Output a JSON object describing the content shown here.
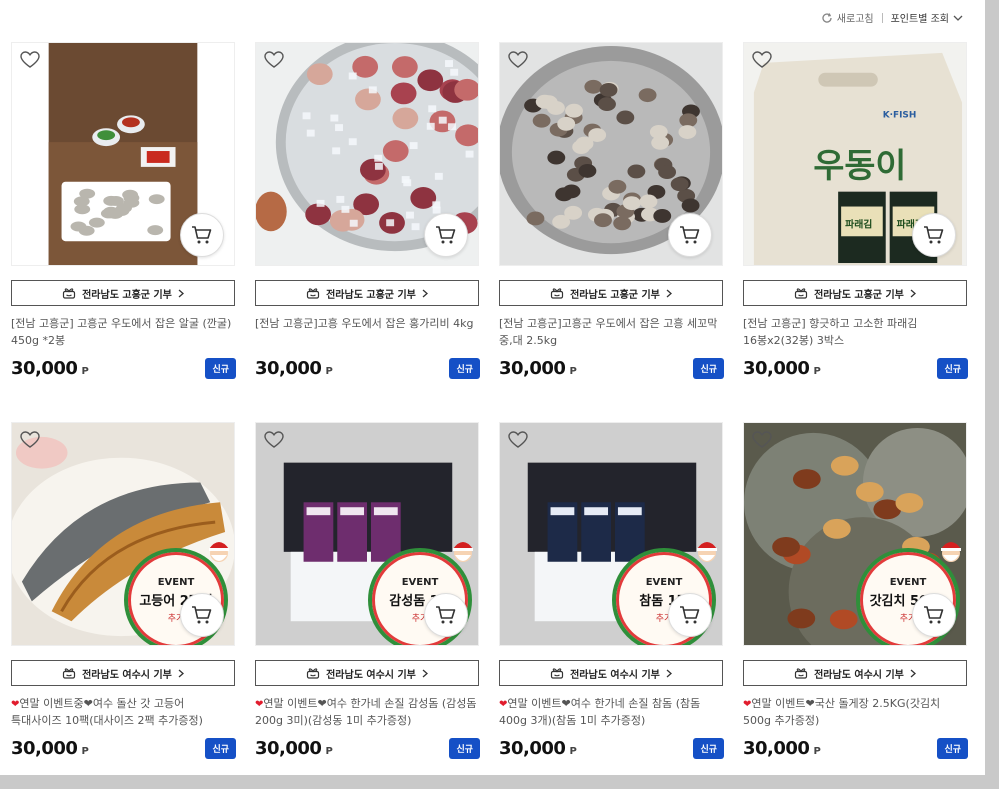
{
  "toolbar": {
    "refresh_label": "새로고침",
    "sort_label": "포인트별 조회"
  },
  "products": [
    {
      "donate": "전라남도 고흥군 기부",
      "title": "[전남 고흥군] 고흥군 우도에서 잡은 알굴 (깐굴) 450g *2봉",
      "price": "30,000",
      "unit": "P",
      "badge": "신규",
      "image": "oysters"
    },
    {
      "donate": "전라남도 고흥군 기부",
      "title": "[전남 고흥군]고흥 우도에서 잡은 홍가리비 4kg",
      "price": "30,000",
      "unit": "P",
      "badge": "신규",
      "image": "scallops"
    },
    {
      "donate": "전라남도 고흥군 기부",
      "title": "[전남 고흥군]고흥군 우도에서 잡은 고흥 세꼬막 중,대 2.5kg",
      "price": "30,000",
      "unit": "P",
      "badge": "신규",
      "image": "cockles"
    },
    {
      "donate": "전라남도 고흥군 기부",
      "title": "[전남 고흥군] 향긋하고 고소한 파래김 16봉x2(32봉) 3박스",
      "price": "30,000",
      "unit": "P",
      "badge": "신규",
      "image": "seaweed",
      "box_brand": "K·FISH",
      "box_text": "우동이",
      "pack_text": "파래김"
    },
    {
      "donate": "전라남도 여수시 기부",
      "title_icon": "❤",
      "title": "연말 이벤트중❤여수 돌산 갓 고등어 특대사이즈 10팩(대사이즈 2팩 추가증정)",
      "price": "30,000",
      "unit": "P",
      "badge": "신규",
      "image": "mackerel",
      "event": "EVENT",
      "event_text": "고등어 2마리",
      "event_add": "추가"
    },
    {
      "donate": "전라남도 여수시 기부",
      "title_icon": "❤",
      "title": "연말 이벤트❤여수 한가네 손질 감성돔 (감성돔 200g 3미)(감성동 1미 추가증정)",
      "price": "30,000",
      "unit": "P",
      "badge": "신규",
      "image": "seabream",
      "event": "EVENT",
      "event_text": "감성돔 1미",
      "event_add": "추가"
    },
    {
      "donate": "전라남도 여수시 기부",
      "title_icon": "❤",
      "title": "연말 이벤트❤여수 한가네 손질 참돔 (참돔 400g 3개)(참돔 1미 추가증정)",
      "price": "30,000",
      "unit": "P",
      "badge": "신규",
      "image": "redbream",
      "event": "EVENT",
      "event_text": "참돔 1미",
      "event_add": "추가"
    },
    {
      "donate": "전라남도 여수시 기부",
      "title_icon": "❤",
      "title": "연말 이벤트❤국산 돌게장 2.5KG(갓김치 500g 추가증정)",
      "price": "30,000",
      "unit": "P",
      "badge": "신규",
      "image": "crabs",
      "event": "EVENT",
      "event_text": "갓김치 500g",
      "event_add": "추가"
    }
  ],
  "colors": {
    "accent": "#1550c6",
    "badge_text": "#ffffff",
    "price": "#111111",
    "heart_emoji": "#e11d2e"
  },
  "icons": {
    "wishlist": "heart-outline-icon",
    "cart": "cart-icon",
    "donate": "gift-box-icon",
    "chevron": "chevron-right-icon",
    "refresh": "refresh-icon",
    "sort": "chevron-down-icon"
  }
}
